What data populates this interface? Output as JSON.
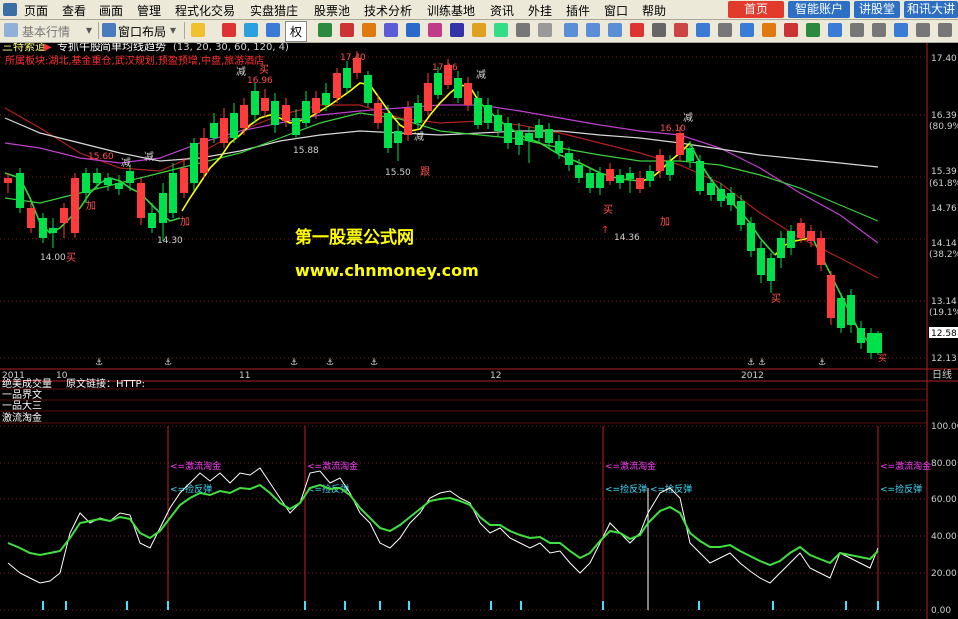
{
  "menu": {
    "items": [
      "页面",
      "查看",
      "画面",
      "管理",
      "程式化交易",
      "实盘猎庄",
      "股票池",
      "技术分析",
      "训练基地",
      "资讯",
      "外挂",
      "插件",
      "窗口",
      "帮助"
    ],
    "right_buttons": [
      {
        "label": "首页",
        "color": "#e23b2e"
      },
      {
        "label": "智能账户",
        "color": "#2d6fc4"
      },
      {
        "label": "讲股堂",
        "color": "#2d6fc4"
      },
      {
        "label": "和讯大讲",
        "color": "#2d6fc4"
      }
    ]
  },
  "toolbar": {
    "basic_quotes": "基本行情",
    "window_layout": "窗口布局",
    "quan_label": "权"
  },
  "chart_header": {
    "stock_name": "三特索道",
    "indicator1": "专抓牛股",
    "indicator2": "简单均线趋势",
    "params": "(13, 20, 30, 60, 120, 4)",
    "sector_text": "所属板块:湖北,基金重仓,武汉规划,预盈预增,中盘,旅游酒店"
  },
  "price_axis": {
    "labels": [
      "17.40",
      "16.39",
      "(80.9%)",
      "15.39",
      "(61.8%)",
      "14.76",
      "14.14",
      "(38.2%)",
      "13.14",
      "(19.1%)",
      "12.58",
      "12.13"
    ],
    "current_price": "12.58"
  },
  "date_axis": {
    "labels": [
      "2011",
      "10",
      "11",
      "12",
      "2012"
    ],
    "period": "日线"
  },
  "annotations": {
    "price_marks": [
      "17.40",
      "17.16",
      "16.96",
      "16.10",
      "15.88",
      "15.60",
      "15.50",
      "14.36",
      "14.30",
      "14.00"
    ],
    "signals": [
      "减",
      "减",
      "减",
      "减",
      "减",
      "减",
      "买",
      "买",
      "买",
      "买",
      "加",
      "加",
      "加",
      "跟"
    ]
  },
  "watermark": {
    "line1": "第一股票公式网",
    "line2": "www.chnmoney.com"
  },
  "indicator_panel": {
    "title": "绝美成交量",
    "link": "原文链接：HTTP:",
    "subtitles": [
      "一品界文",
      "一品大三",
      "激流淘金"
    ],
    "labels": [
      "<=激流淘金",
      "<=捡反弹"
    ],
    "axis_labels": [
      "100.00",
      "80.00",
      "60.00",
      "40.00",
      "20.00",
      "0.00"
    ]
  },
  "colors": {
    "up": "#ff3c3c",
    "down": "#00e04a",
    "ma_white": "#e8e8e8",
    "ma_yellow": "#ffff00",
    "ma_green": "#3cd03c",
    "ma_magenta": "#c040d0",
    "ma_red": "#b02020",
    "label_magenta": "#ff40ff",
    "label_cyan": "#40e0ff",
    "price_tag_bg": "#ffffff"
  }
}
